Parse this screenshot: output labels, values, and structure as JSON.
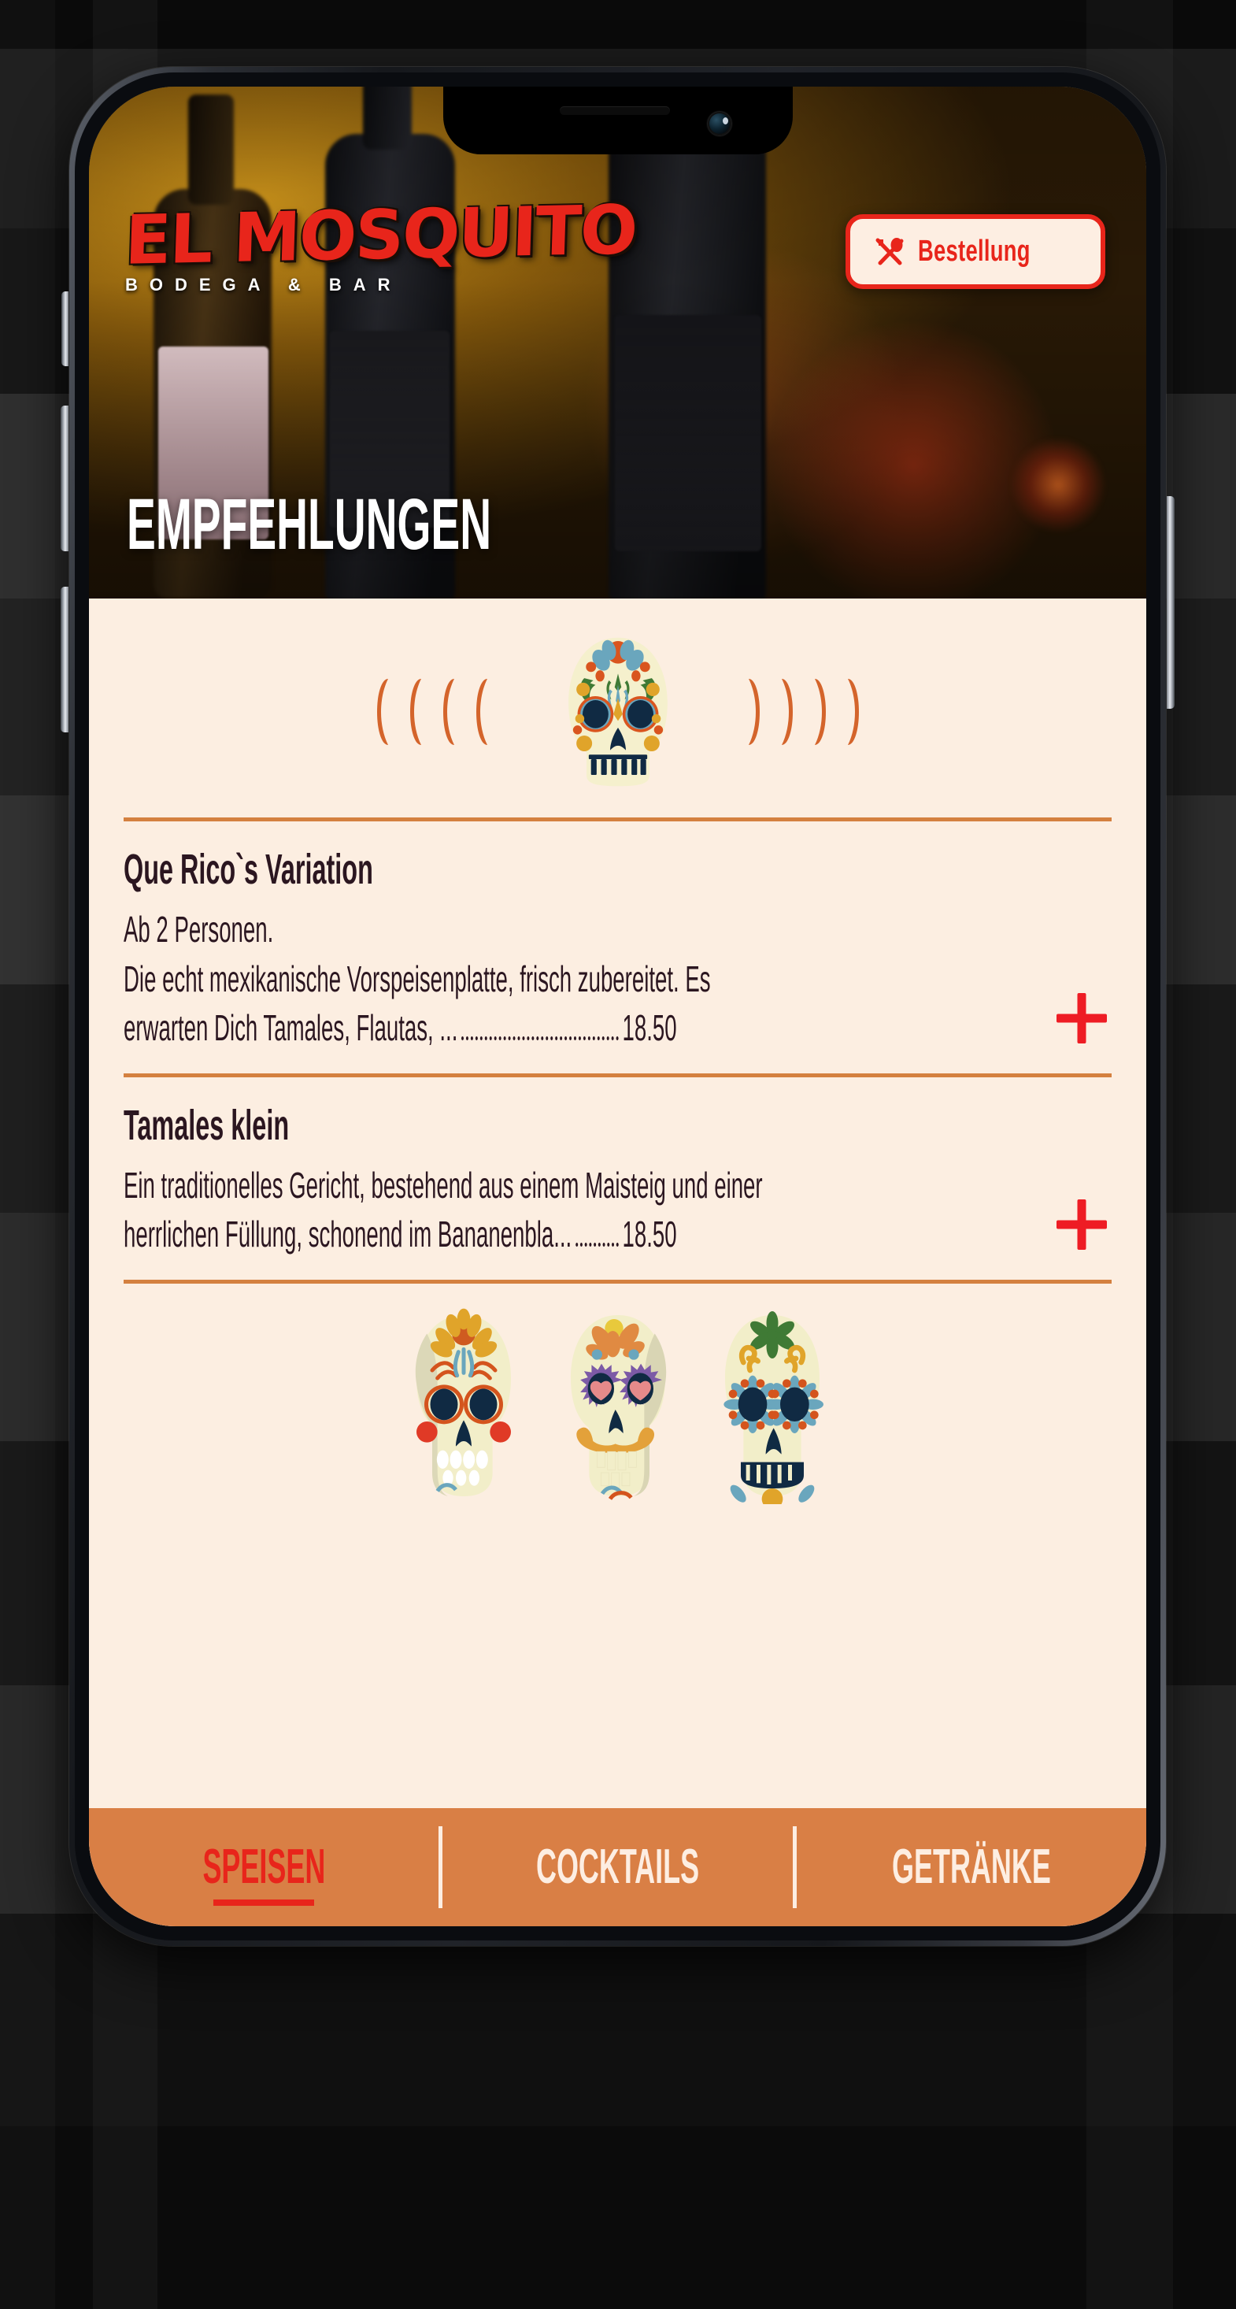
{
  "header": {
    "logo_main": "EL MOSQUITO",
    "logo_sub": "BODEGA & BAR",
    "order_button_label": "Bestellung",
    "order_button_icon": "cutlery-cross-icon",
    "section_title": "EMPFEHLUNGEN"
  },
  "carousel": {
    "prev_icon": "chevron-left-triple-icon",
    "next_icon": "chevron-right-triple-icon",
    "center_icon": "sugar-skull-icon"
  },
  "menu_items": [
    {
      "name": "Que Rico`s Variation",
      "desc_lines": [
        "Ab 2 Personen.",
        "Die echt mexikanische Vorspeisenplatte, frisch zubereitet. Es",
        "erwarten Dich Tamales, Flautas, ..."
      ],
      "price": "18.50",
      "add_icon": "plus-icon"
    },
    {
      "name": "Tamales klein",
      "desc_lines": [
        "Ein traditionelles Gericht, bestehend aus einem Maisteig und einer",
        "herrlichen Füllung, schonend im Bananenbla..."
      ],
      "price": "18.50",
      "add_icon": "plus-icon"
    }
  ],
  "footer_decor": {
    "skulls": [
      "sugar-skull-flower-icon",
      "sugar-skull-mustache-icon",
      "sugar-skull-star-icon"
    ]
  },
  "tabs": [
    {
      "label": "SPEISEN",
      "active": true
    },
    {
      "label": "COCKTAILS",
      "active": false
    },
    {
      "label": "GETRÄNKE",
      "active": false
    }
  ],
  "colors": {
    "cream": "#fceee1",
    "orange": "#d97f45",
    "divider_orange": "#d4803f",
    "red": "#e8251b",
    "plus_red": "#ee1c24",
    "text_dark": "#2b1620"
  }
}
